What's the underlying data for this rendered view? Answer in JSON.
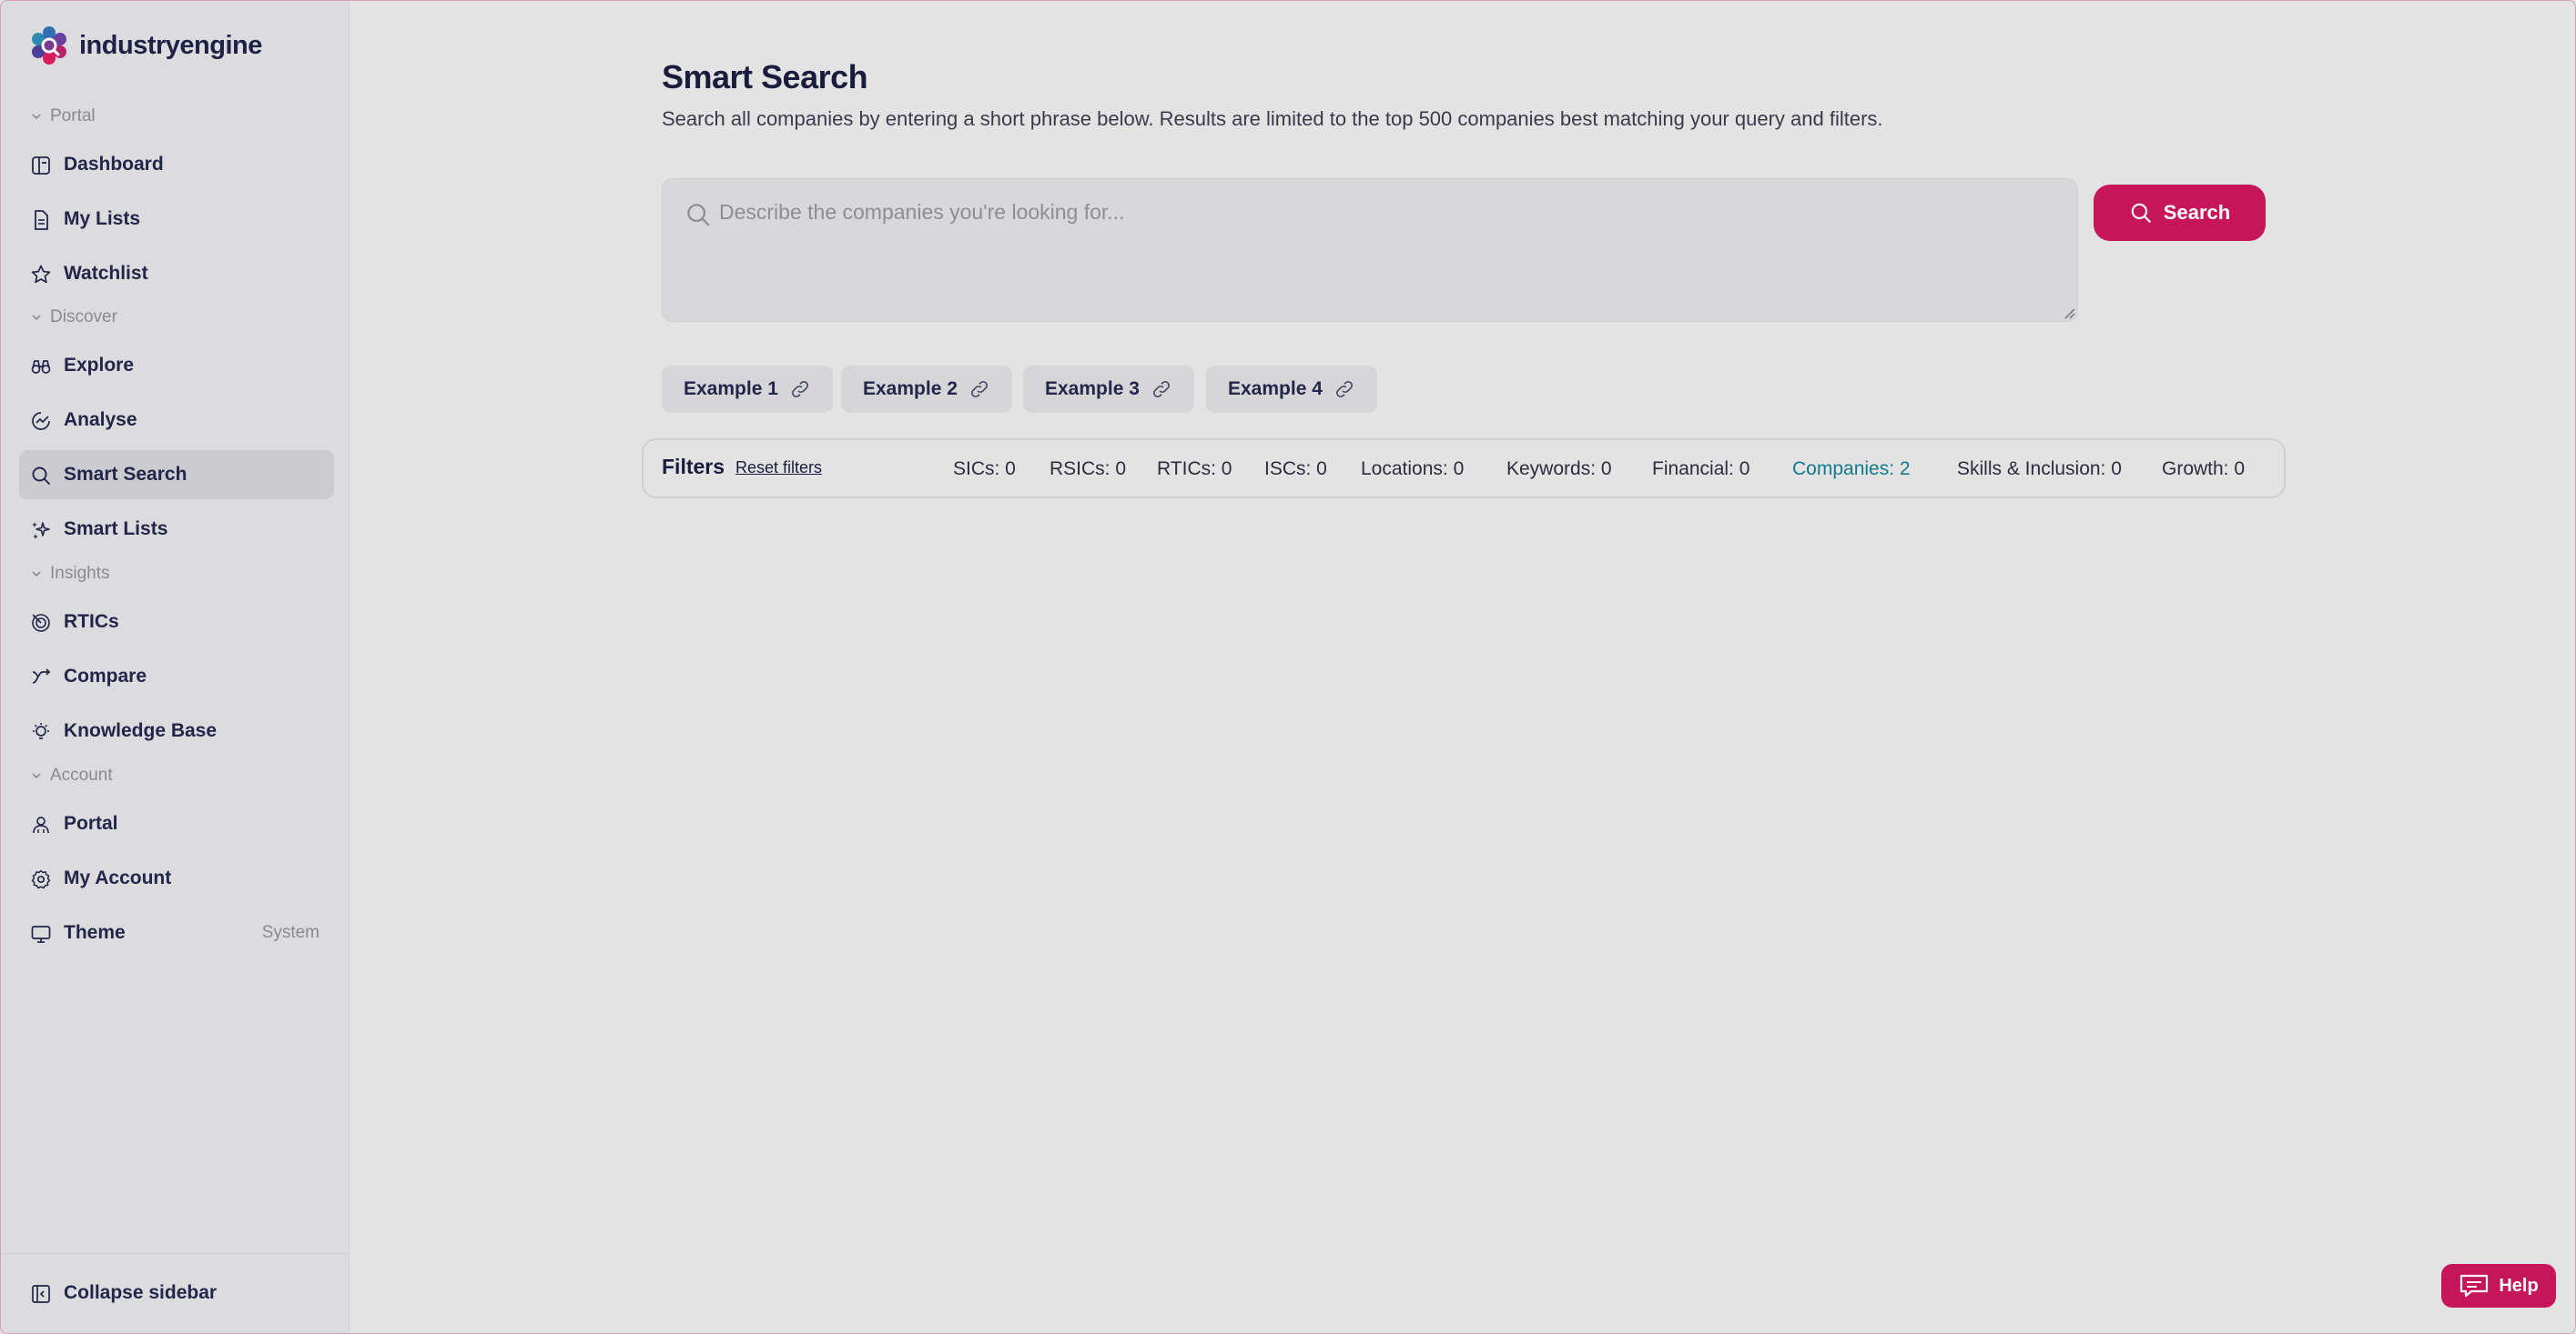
{
  "brand": {
    "name": "industryengine"
  },
  "sidebar": {
    "sections": {
      "portal": "Portal",
      "discover": "Discover",
      "insights": "Insights",
      "account": "Account"
    },
    "items": {
      "dashboard": "Dashboard",
      "my_lists": "My Lists",
      "watchlist": "Watchlist",
      "explore": "Explore",
      "analyse": "Analyse",
      "smart_search": "Smart Search",
      "smart_lists": "Smart Lists",
      "rtics": "RTICs",
      "compare": "Compare",
      "knowledge_base": "Knowledge Base",
      "portal": "Portal",
      "my_account": "My Account",
      "theme": "Theme",
      "theme_value": "System"
    },
    "collapse_label": "Collapse sidebar",
    "active_item": "Smart Search"
  },
  "main": {
    "title": "Smart Search",
    "subtitle": "Search all companies by entering a short phrase below. Results are limited to the top 500 companies best matching your query and filters.",
    "search_placeholder": "Describe the companies you're looking for...",
    "search_value": "",
    "search_button": "Search",
    "examples": [
      "Example 1",
      "Example 2",
      "Example 3",
      "Example 4"
    ],
    "filters": {
      "title": "Filters",
      "reset": "Reset filters",
      "items": [
        "SICs: 0",
        "RSICs: 0",
        "RTICs: 0",
        "ISCs: 0",
        "Locations: 0",
        "Keywords: 0",
        "Financial: 0",
        "Companies: 2",
        "Skills & Inclusion: 0",
        "Growth: 0"
      ]
    }
  },
  "help": {
    "label": "Help"
  },
  "colors": {
    "accent": "#c71559",
    "highlight": "#137a8e",
    "sidebar_bg": "#dcdcde",
    "page_bg": "#e3e3e3"
  }
}
